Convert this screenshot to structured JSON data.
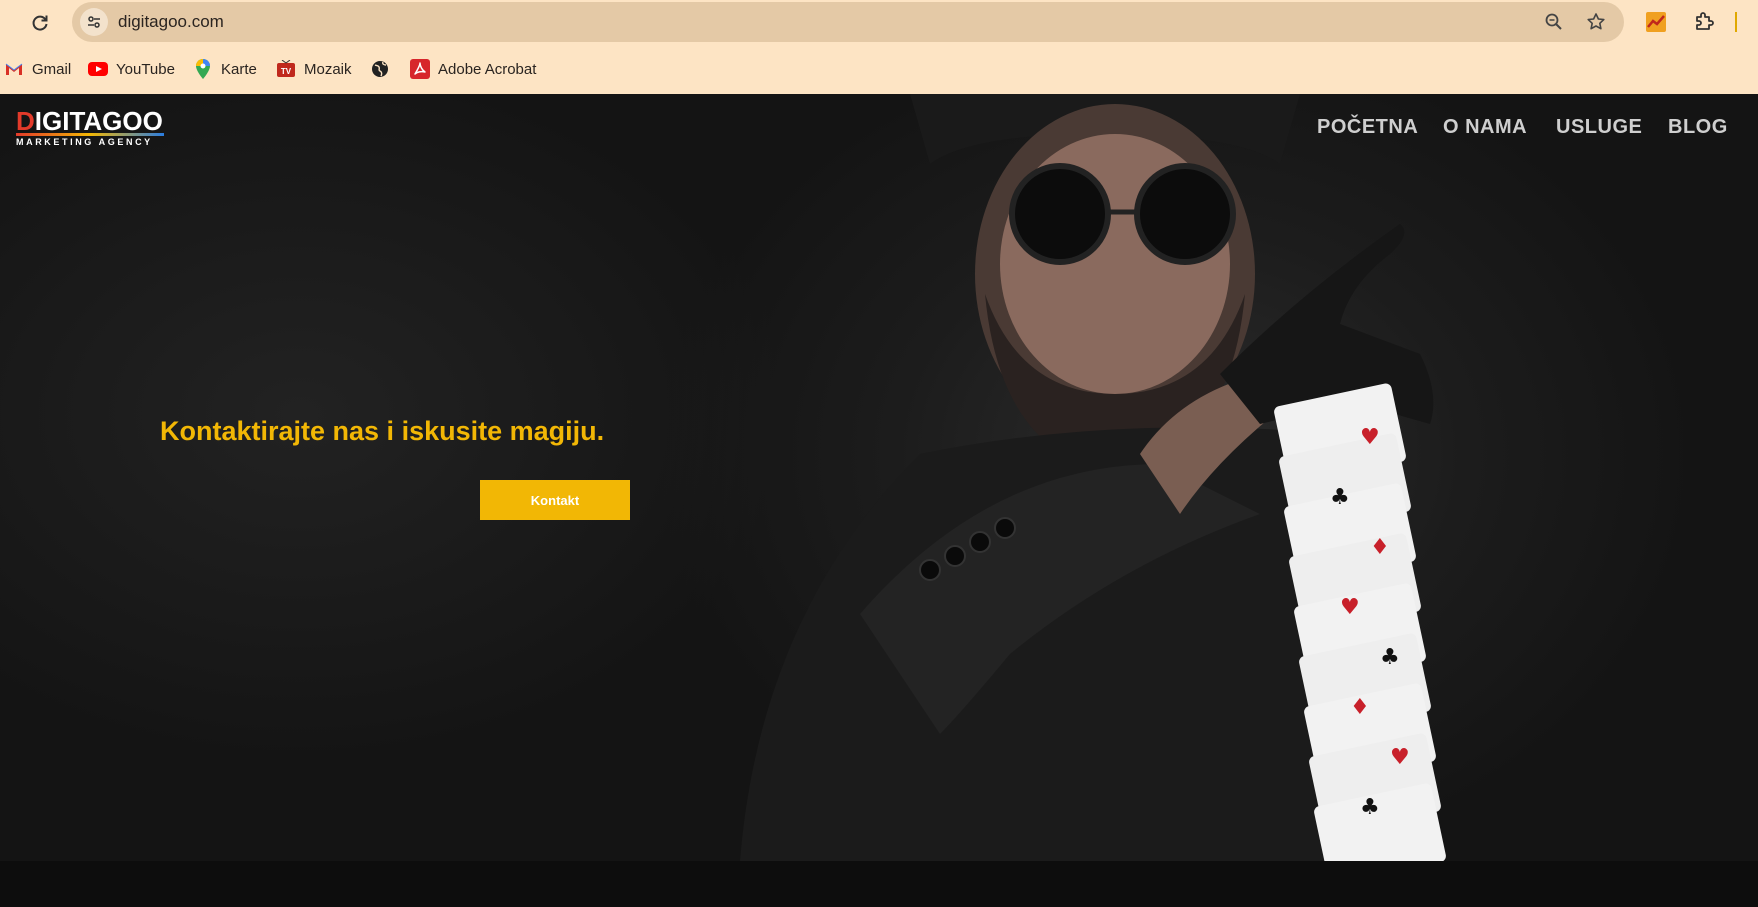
{
  "browser": {
    "url": "digitagoo.com",
    "bookmarks": [
      {
        "label": "Gmail",
        "icon": "gmail-icon"
      },
      {
        "label": "YouTube",
        "icon": "youtube-icon"
      },
      {
        "label": "Karte",
        "icon": "maps-pin-icon"
      },
      {
        "label": "Mozaik",
        "icon": "mozaik-tv-icon"
      },
      {
        "label": "",
        "icon": "globe-icon"
      },
      {
        "label": "Adobe Acrobat",
        "icon": "acrobat-icon"
      }
    ],
    "colors": {
      "chrome_bg": "#fde4c4",
      "omnibox_bg": "#e4c9a6"
    }
  },
  "site": {
    "logo": {
      "brand": "IGITAGOO",
      "brand_initial": "D",
      "tagline": "MARKETING AGENCY"
    },
    "nav": [
      "POČETNA",
      "O NAMA",
      "USLUGE",
      "BLOG"
    ],
    "hero": {
      "headline": "Kontaktirajte nas i iskusite magiju.",
      "cta_label": "Kontakt"
    },
    "colors": {
      "accent": "#f2b705",
      "background": "#141414",
      "nav_text": "#cfcfcf"
    }
  }
}
